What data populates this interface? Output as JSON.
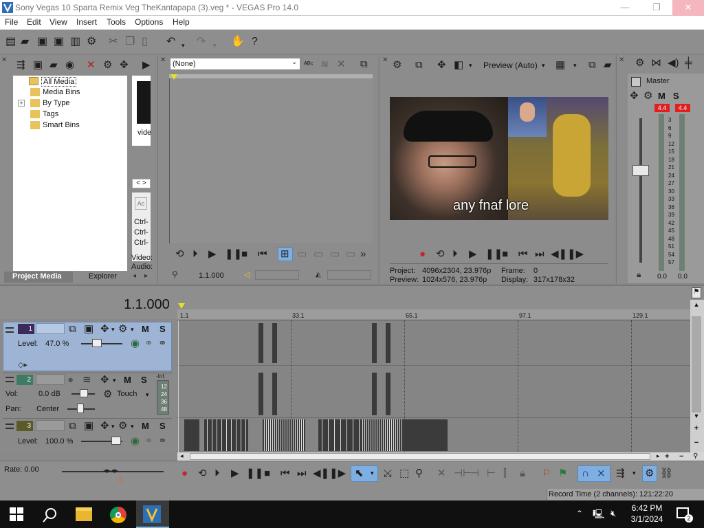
{
  "window": {
    "title": "Sony Vegas 10 Sparta Remix Veg TheKantapapa (3).veg * - VEGAS Pro 14.0",
    "controls": {
      "minimize": "—",
      "maximize": "❐",
      "close": "✕"
    }
  },
  "menu": [
    "File",
    "Edit",
    "View",
    "Insert",
    "Tools",
    "Options",
    "Help"
  ],
  "project_media": {
    "tree": [
      "All Media",
      "Media Bins",
      "By Type",
      "Tags",
      "Smart Bins"
    ],
    "expander": "+",
    "thumb_label": "vide",
    "meta_labels": [
      "Ctrl-",
      "Ctrl-",
      "Ctrl-",
      "Video:",
      "Audio:"
    ],
    "tabs": [
      "Project Media",
      "Explorer"
    ]
  },
  "trimmer": {
    "dropdown_value": "(None)",
    "timecode": "1.1.000"
  },
  "preview": {
    "mode": "Preview (Auto)",
    "caption": "any fnaf lore",
    "project_label": "Project:",
    "project_value": "4096x2304, 23.976p",
    "preview_label": "Preview:",
    "preview_value": "1024x576, 23.976p",
    "frame_label": "Frame:",
    "frame_value": "0",
    "display_label": "Display:",
    "display_value": "317x178x32"
  },
  "mixer": {
    "master_label": "Master",
    "m": "M",
    "s": "S",
    "peak_left": "4.4",
    "peak_right": "4.4",
    "scale": [
      "3",
      "6",
      "9",
      "12",
      "15",
      "18",
      "21",
      "24",
      "27",
      "30",
      "33",
      "36",
      "39",
      "42",
      "45",
      "48",
      "51",
      "54",
      "57"
    ],
    "bottom_left": "0.0",
    "bottom_right": "0.0"
  },
  "timeline": {
    "cursor_time": "1.1.000",
    "ruler_marks": [
      "1.1",
      "33.1",
      "65.1",
      "97.1",
      "129.1"
    ],
    "tracks": [
      {
        "number": "1",
        "level_label": "Level:",
        "level_value": "47.0 %",
        "m": "M",
        "s": "S"
      },
      {
        "number": "2",
        "vol_label": "Vol:",
        "vol_value": "0.0 dB",
        "pan_label": "Pan:",
        "pan_value": "Center",
        "touch_label": "Touch",
        "m": "M",
        "s": "S",
        "inf_label": "-Inf.",
        "meter_marks": [
          "12",
          "24",
          "36",
          "48"
        ]
      },
      {
        "number": "3",
        "level_label": "Level:",
        "level_value": "100.0 %",
        "m": "M",
        "s": "S"
      }
    ],
    "rate_label": "Rate: 0.00",
    "record_time": "Record Time (2 channels): 121:22:20"
  },
  "taskbar": {
    "time": "6:42 PM",
    "date": "3/1/2024",
    "notification_count": "2"
  },
  "colors": {
    "panel_bg": "#8c8c8c",
    "selected_track": "#9db4d4",
    "record_red": "#c0282c",
    "meter_peak": "#e02020",
    "taskbar": "#101010"
  }
}
